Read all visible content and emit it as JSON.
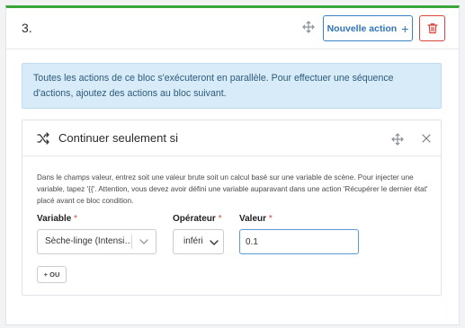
{
  "block": {
    "step_label": "3.",
    "new_action_label": "Nouvelle action",
    "new_action_icon": "plus-icon",
    "delete_icon": "trash-icon",
    "move_icon": "move-arrows-icon"
  },
  "info_alert": {
    "text": "Toutes les actions de ce bloc s'exécuteront en parallèle. Pour effectuer une séquence d'actions, ajoutez des actions au bloc suivant."
  },
  "condition": {
    "title": "Continuer seulement si",
    "title_icon": "shuffle-icon",
    "help_text": "Dans le champs valeur, entrez soit une valeur brute soit un calcul basé sur une variable de scène. Pour injecter une variable, tapez '{{'. Attention, vous devez avoir défini une variable auparavant dans une action 'Récupérer le dernier état' placé avant ce bloc condition.",
    "variable_label": "Variable",
    "variable_value": "Sèche-linge (Intensité)",
    "operator_label": "Opérateur",
    "operator_value": "inféri",
    "value_label": "Valeur",
    "value_value": "0.1",
    "required_mark": "*",
    "or_button_label": "+ OU"
  },
  "colors": {
    "accent_green": "#3aa53a",
    "primary_blue": "#2f74b5",
    "danger_red": "#d9453f",
    "info_bg": "#d7ebf8"
  }
}
